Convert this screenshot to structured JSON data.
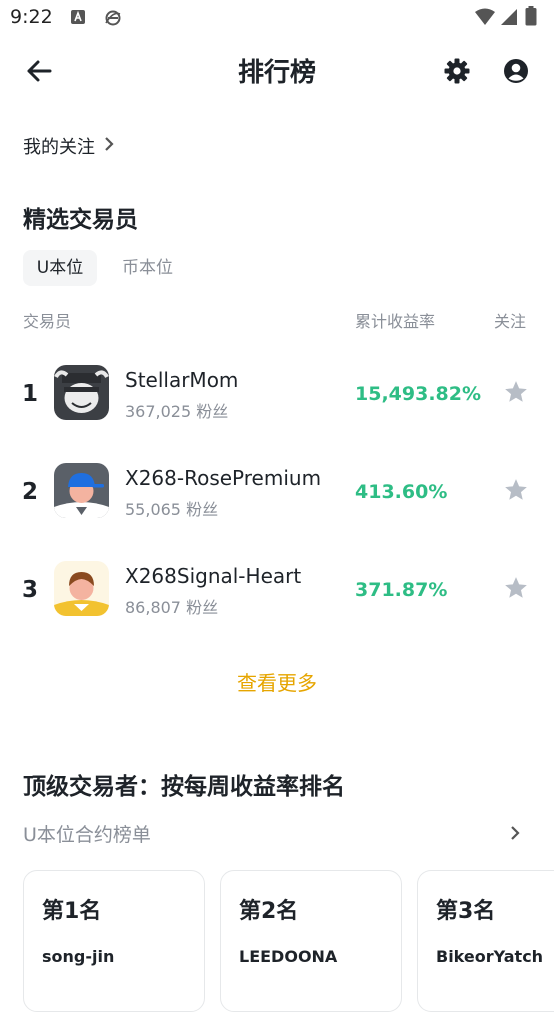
{
  "status": {
    "time": "9:22"
  },
  "header": {
    "title": "排行榜"
  },
  "following": {
    "label": "我的关注"
  },
  "featured": {
    "title": "精选交易员",
    "tabs": [
      {
        "label": "U本位"
      },
      {
        "label": "币本位"
      }
    ],
    "columns": {
      "trader": "交易员",
      "roi": "累计收益率",
      "follow": "关注"
    },
    "traders": [
      {
        "rank": "1",
        "name": "StellarMom",
        "fans": "367,025 粉丝",
        "roi": "15,493.82%"
      },
      {
        "rank": "2",
        "name": "X268-RosePremium",
        "fans": "55,065 粉丝",
        "roi": "413.60%"
      },
      {
        "rank": "3",
        "name": "X268Signal-Heart",
        "fans": "86,807 粉丝",
        "roi": "371.87%"
      }
    ],
    "more": "查看更多"
  },
  "weekly": {
    "title": "顶级交易者：按每周收益率排名",
    "board_label": "U本位合约榜单",
    "cards": [
      {
        "rank": "第1名",
        "name": "song-jin"
      },
      {
        "rank": "第2名",
        "name": "LEEDOONA"
      },
      {
        "rank": "第3名",
        "name": "BikeorYatch"
      }
    ]
  },
  "colors": {
    "accent": "#e6a500",
    "positive": "#2ebd85",
    "muted": "#8a8f98",
    "text": "#1e2329"
  }
}
